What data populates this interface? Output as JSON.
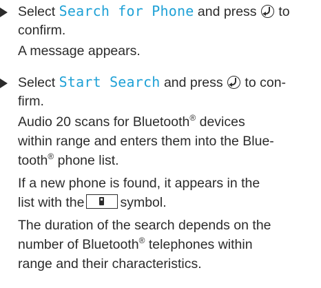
{
  "step1": {
    "t1": "Select ",
    "mono": "Search for Phone",
    "t2": " and press ",
    "knob": "controller-press-icon",
    "t3": " to",
    "line2": "confirm.",
    "result": "A message appears."
  },
  "step2": {
    "t1": "Select ",
    "mono": "Start Search",
    "t2": " and press ",
    "knob": "controller-press-icon",
    "t3": " to con-",
    "line2": "firm.",
    "p1": {
      "l1a": "Audio 20 scans for Bluetooth",
      "l1b": " devices",
      "l2": "within range and enters them into the Blue-",
      "l3a": "tooth",
      "l3b": " phone list."
    },
    "p2": {
      "l1": "If a new phone is found, it appears in the",
      "l2a": "list with the",
      "l2b": "symbol.",
      "symbol": "phone-symbol-icon"
    },
    "p3": {
      "l1": "The duration of the search depends on the",
      "l2a": "number of Bluetooth",
      "l2b": " telephones within",
      "l3": "range and their characteristics."
    },
    "reg": "®"
  }
}
